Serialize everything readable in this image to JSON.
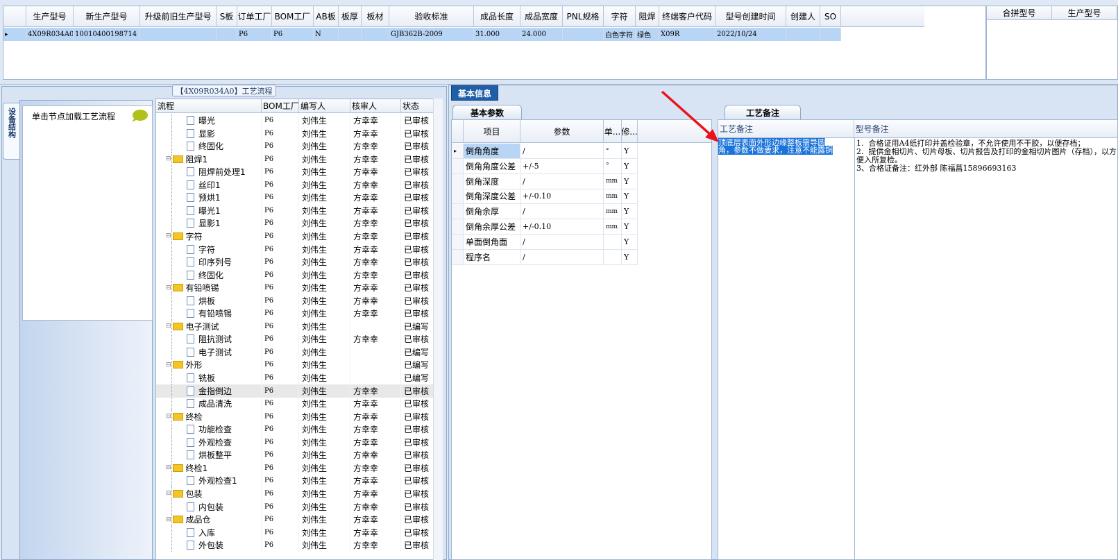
{
  "order_grid": {
    "columns": [
      "生产型号",
      "新生产型号",
      "升级前旧生产型号",
      "S板",
      "订单工厂",
      "BOM工厂",
      "AB板",
      "板厚",
      "板材",
      "验收标准",
      "成品长度",
      "成品宽度",
      "PNL规格",
      "字符",
      "阻焊",
      "终端客户代码",
      "型号创建时间",
      "创建人",
      "SO"
    ],
    "row": [
      "4X09R034A0",
      "10010400198714",
      "",
      "",
      "P6",
      "P6",
      "N",
      "",
      "",
      "GJB362B-2009",
      "31.000",
      "24.000",
      "",
      "白色字符",
      "绿色",
      "X09R",
      "2022/10/24",
      "",
      ""
    ]
  },
  "merge_grid": {
    "columns": [
      "合拼型号",
      "生产型号"
    ]
  },
  "flow_title": "【4X09R034A0】工艺流程",
  "side_tab": "设备结构",
  "device_hint": "单击节点加载工艺流程",
  "tree": {
    "columns": [
      "流程",
      "BOM工厂",
      "编写人",
      "核审人",
      "状态"
    ],
    "rows": [
      {
        "name": "曝光",
        "level": 2,
        "folder": false,
        "bom": "P6",
        "writer": "刘伟生",
        "reviewer": "方幸幸",
        "status": "已审核"
      },
      {
        "name": "显影",
        "level": 2,
        "folder": false,
        "bom": "P6",
        "writer": "刘伟生",
        "reviewer": "方幸幸",
        "status": "已审核"
      },
      {
        "name": "终固化",
        "level": 2,
        "folder": false,
        "bom": "P6",
        "writer": "刘伟生",
        "reviewer": "方幸幸",
        "status": "已审核"
      },
      {
        "name": "阻焊1",
        "level": 1,
        "folder": true,
        "bom": "P6",
        "writer": "刘伟生",
        "reviewer": "方幸幸",
        "status": "已审核"
      },
      {
        "name": "阻焊前处理1",
        "level": 2,
        "folder": false,
        "bom": "P6",
        "writer": "刘伟生",
        "reviewer": "方幸幸",
        "status": "已审核"
      },
      {
        "name": "丝印1",
        "level": 2,
        "folder": false,
        "bom": "P6",
        "writer": "刘伟生",
        "reviewer": "方幸幸",
        "status": "已审核"
      },
      {
        "name": "预烘1",
        "level": 2,
        "folder": false,
        "bom": "P6",
        "writer": "刘伟生",
        "reviewer": "方幸幸",
        "status": "已审核"
      },
      {
        "name": "曝光1",
        "level": 2,
        "folder": false,
        "bom": "P6",
        "writer": "刘伟生",
        "reviewer": "方幸幸",
        "status": "已审核"
      },
      {
        "name": "显影1",
        "level": 2,
        "folder": false,
        "bom": "P6",
        "writer": "刘伟生",
        "reviewer": "方幸幸",
        "status": "已审核"
      },
      {
        "name": "字符",
        "level": 1,
        "folder": true,
        "bom": "P6",
        "writer": "刘伟生",
        "reviewer": "方幸幸",
        "status": "已审核"
      },
      {
        "name": "字符",
        "level": 2,
        "folder": false,
        "bom": "P6",
        "writer": "刘伟生",
        "reviewer": "方幸幸",
        "status": "已审核"
      },
      {
        "name": "印序列号",
        "level": 2,
        "folder": false,
        "bom": "P6",
        "writer": "刘伟生",
        "reviewer": "方幸幸",
        "status": "已审核"
      },
      {
        "name": "终固化",
        "level": 2,
        "folder": false,
        "bom": "P6",
        "writer": "刘伟生",
        "reviewer": "方幸幸",
        "status": "已审核"
      },
      {
        "name": "有铅喷锡",
        "level": 1,
        "folder": true,
        "bom": "P6",
        "writer": "刘伟生",
        "reviewer": "方幸幸",
        "status": "已审核"
      },
      {
        "name": "烘板",
        "level": 2,
        "folder": false,
        "bom": "P6",
        "writer": "刘伟生",
        "reviewer": "方幸幸",
        "status": "已审核"
      },
      {
        "name": "有铅喷锡",
        "level": 2,
        "folder": false,
        "bom": "P6",
        "writer": "刘伟生",
        "reviewer": "方幸幸",
        "status": "已审核"
      },
      {
        "name": "电子测试",
        "level": 1,
        "folder": true,
        "bom": "P6",
        "writer": "刘伟生",
        "reviewer": "",
        "status": "已编写"
      },
      {
        "name": "阻抗测试",
        "level": 2,
        "folder": false,
        "bom": "P6",
        "writer": "刘伟生",
        "reviewer": "方幸幸",
        "status": "已审核"
      },
      {
        "name": "电子测试",
        "level": 2,
        "folder": false,
        "bom": "P6",
        "writer": "刘伟生",
        "reviewer": "",
        "status": "已编写"
      },
      {
        "name": "外形",
        "level": 1,
        "folder": true,
        "bom": "P6",
        "writer": "刘伟生",
        "reviewer": "",
        "status": "已编写"
      },
      {
        "name": "铣板",
        "level": 2,
        "folder": false,
        "bom": "P6",
        "writer": "刘伟生",
        "reviewer": "",
        "status": "已编写"
      },
      {
        "name": "金指倒边",
        "level": 2,
        "folder": false,
        "bom": "P6",
        "writer": "刘伟生",
        "reviewer": "方幸幸",
        "status": "已审核",
        "selected": true
      },
      {
        "name": "成品清洗",
        "level": 2,
        "folder": false,
        "bom": "P6",
        "writer": "刘伟生",
        "reviewer": "方幸幸",
        "status": "已审核"
      },
      {
        "name": "终检",
        "level": 1,
        "folder": true,
        "bom": "P6",
        "writer": "刘伟生",
        "reviewer": "方幸幸",
        "status": "已审核"
      },
      {
        "name": "功能检查",
        "level": 2,
        "folder": false,
        "bom": "P6",
        "writer": "刘伟生",
        "reviewer": "方幸幸",
        "status": "已审核"
      },
      {
        "name": "外观检查",
        "level": 2,
        "folder": false,
        "bom": "P6",
        "writer": "刘伟生",
        "reviewer": "方幸幸",
        "status": "已审核"
      },
      {
        "name": "烘板整平",
        "level": 2,
        "folder": false,
        "bom": "P6",
        "writer": "刘伟生",
        "reviewer": "方幸幸",
        "status": "已审核"
      },
      {
        "name": "终检1",
        "level": 1,
        "folder": true,
        "bom": "P6",
        "writer": "刘伟生",
        "reviewer": "方幸幸",
        "status": "已审核"
      },
      {
        "name": "外观检查1",
        "level": 2,
        "folder": false,
        "bom": "P6",
        "writer": "刘伟生",
        "reviewer": "方幸幸",
        "status": "已审核"
      },
      {
        "name": "包装",
        "level": 1,
        "folder": true,
        "bom": "P6",
        "writer": "刘伟生",
        "reviewer": "方幸幸",
        "status": "已审核"
      },
      {
        "name": "内包装",
        "level": 2,
        "folder": false,
        "bom": "P6",
        "writer": "刘伟生",
        "reviewer": "方幸幸",
        "status": "已审核"
      },
      {
        "name": "成品仓",
        "level": 1,
        "folder": true,
        "bom": "P6",
        "writer": "刘伟生",
        "reviewer": "方幸幸",
        "status": "已审核"
      },
      {
        "name": "入库",
        "level": 2,
        "folder": false,
        "bom": "P6",
        "writer": "刘伟生",
        "reviewer": "方幸幸",
        "status": "已审核"
      },
      {
        "name": "外包装",
        "level": 2,
        "folder": false,
        "bom": "P6",
        "writer": "刘伟生",
        "reviewer": "方幸幸",
        "status": "已审核"
      }
    ]
  },
  "basic_tab": "基本信息",
  "param_tab": "基本参数",
  "params": {
    "columns": [
      "项目",
      "参数",
      "单...",
      "修..."
    ],
    "rows": [
      {
        "item": "倒角角度",
        "value": "/",
        "unit": "°",
        "mod": "Y"
      },
      {
        "item": "倒角角度公差",
        "value": "+/-5",
        "unit": "°",
        "mod": "Y"
      },
      {
        "item": "倒角深度",
        "value": "/",
        "unit": "mm",
        "mod": "Y"
      },
      {
        "item": "倒角深度公差",
        "value": "+/-0.10",
        "unit": "mm",
        "mod": "Y"
      },
      {
        "item": "倒角余厚",
        "value": "/",
        "unit": "mm",
        "mod": "Y"
      },
      {
        "item": "倒角余厚公差",
        "value": "+/-0.10",
        "unit": "mm",
        "mod": "Y"
      },
      {
        "item": "单面倒角面",
        "value": "/",
        "unit": "",
        "mod": "Y"
      },
      {
        "item": "程序名",
        "value": "/",
        "unit": "",
        "mod": "Y"
      }
    ]
  },
  "note_tab": "工艺备注",
  "notes": {
    "process_header": "工艺备注",
    "model_header": "型号备注",
    "process_text": "顶底层表面外形边缘整板需导圆角，参数不做要求，注意不能露铜",
    "model_text": "1.  合格证用A4纸打印并盖检验章，不允许使用不干胶，以便存档；\n2.  提供金相切片、切片母板、切片报告及打印的金相切片图片（存档），以方便入所复检。\n3、合格证备注：红外部 陈福菖15896693163"
  },
  "colors": {
    "selected_row": "#b9d5f5",
    "tab_active": "#1f5fa8",
    "highlight": "#1a73d9",
    "arrow": "#e8141c"
  }
}
